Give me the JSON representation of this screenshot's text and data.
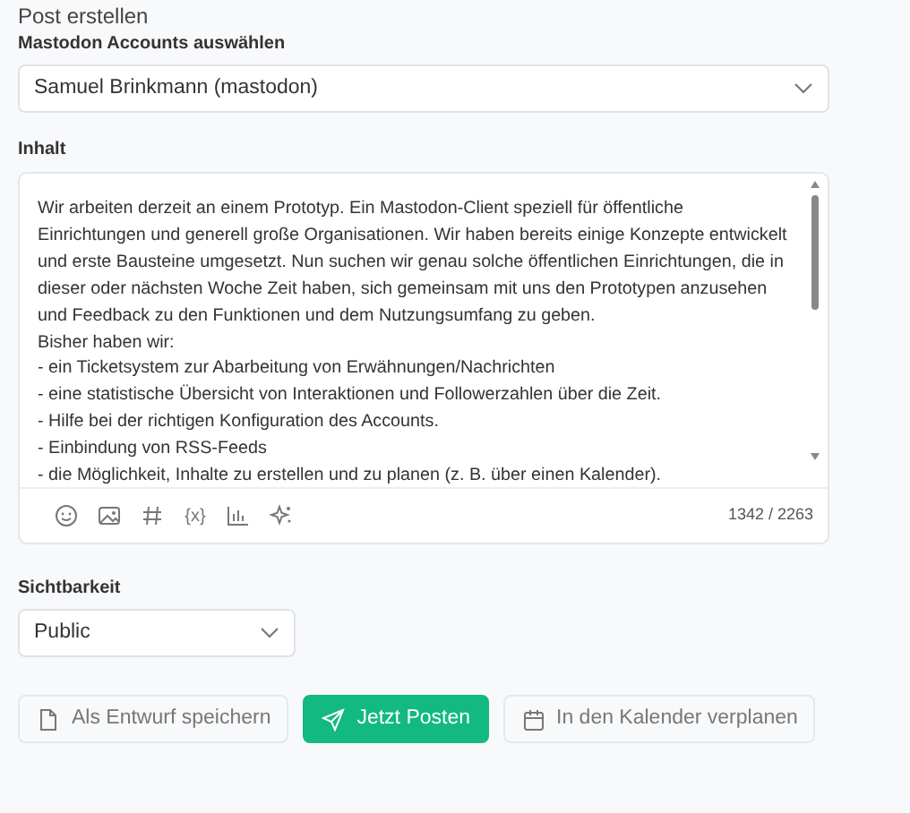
{
  "title": "Post erstellen",
  "account": {
    "label": "Mastodon Accounts auswählen",
    "value": "Samuel Brinkmann (mastodon)"
  },
  "content": {
    "label": "Inhalt",
    "lines": [
      "Wir arbeiten derzeit an einem Prototyp. Ein Mastodon-Client speziell für öffentliche",
      "Einrichtungen und generell große Organisationen. Wir haben bereits einige Konzepte entwickelt",
      "und erste Bausteine umgesetzt. Nun suchen wir genau solche öffentlichen Einrichtungen, die in",
      "dieser oder nächsten Woche Zeit haben, sich gemeinsam mit uns den Prototypen anzusehen",
      "und Feedback zu den Funktionen und dem Nutzungsumfang zu geben.",
      "Bisher haben wir:",
      "- ein Ticketsystem zur Abarbeitung von Erwähnungen/Nachrichten",
      "- eine statistische Übersicht von Interaktionen und Followerzahlen über die Zeit.",
      "- Hilfe bei der richtigen Konfiguration des Accounts.",
      "- Einbindung von RSS-Feeds",
      "- die Möglichkeit, Inhalte zu erstellen und zu planen (z. B. über einen Kalender)."
    ],
    "toolbar": [
      {
        "kind": "emoji"
      },
      {
        "kind": "image"
      },
      {
        "kind": "hashtag"
      },
      {
        "kind": "variable",
        "label": "{x}"
      },
      {
        "kind": "chart"
      },
      {
        "kind": "sparkle"
      }
    ],
    "counter": "1342 / 2263"
  },
  "visibility": {
    "label": "Sichtbarkeit",
    "value": "Public"
  },
  "buttons": [
    {
      "kind": "draft",
      "label": "Als Entwurf speichern"
    },
    {
      "kind": "post",
      "label": "Jetzt Posten"
    },
    {
      "kind": "schedule",
      "label": "In den Kalender verplanen"
    }
  ]
}
